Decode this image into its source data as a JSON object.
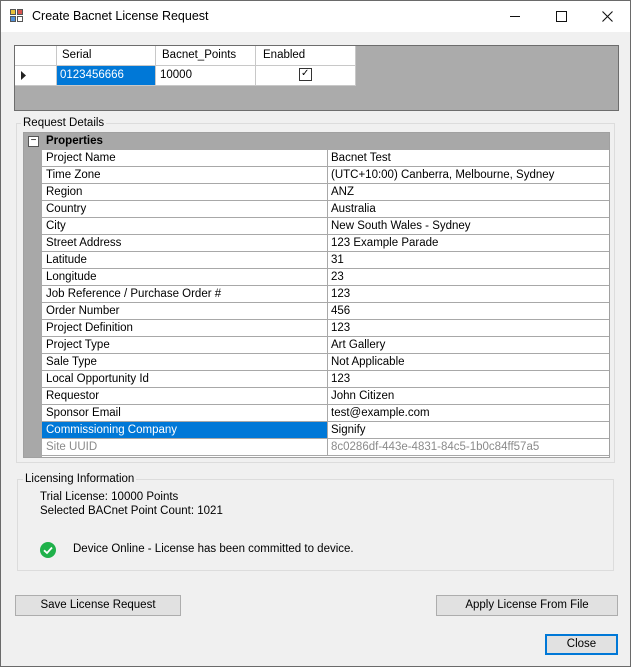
{
  "window": {
    "title": "Create Bacnet License Request"
  },
  "grid": {
    "columns": [
      "Serial",
      "Bacnet_Points",
      "Enabled"
    ],
    "row": {
      "serial": "0123456666",
      "points": "10000",
      "enabled_glyph": "✓"
    }
  },
  "request_details": {
    "title": "Request Details",
    "category": "Properties",
    "collapse_glyph": "−",
    "properties": [
      {
        "name": "Project Name",
        "value": "Bacnet Test"
      },
      {
        "name": "Time Zone",
        "value": "(UTC+10:00) Canberra, Melbourne, Sydney"
      },
      {
        "name": "Region",
        "value": "ANZ"
      },
      {
        "name": "Country",
        "value": "Australia"
      },
      {
        "name": "City",
        "value": "New South Wales - Sydney"
      },
      {
        "name": "Street Address",
        "value": "123 Example Parade"
      },
      {
        "name": "Latitude",
        "value": "31"
      },
      {
        "name": "Longitude",
        "value": "23"
      },
      {
        "name": "Job Reference / Purchase Order #",
        "value": "123"
      },
      {
        "name": "Order Number",
        "value": "456"
      },
      {
        "name": "Project Definition",
        "value": "123"
      },
      {
        "name": "Project Type",
        "value": "Art Gallery"
      },
      {
        "name": "Sale Type",
        "value": "Not Applicable"
      },
      {
        "name": "Local Opportunity Id",
        "value": "123"
      },
      {
        "name": "Requestor",
        "value": "John Citizen"
      },
      {
        "name": "Sponsor Email",
        "value": "test@example.com"
      },
      {
        "name": "Commissioning Company",
        "value": "Signify"
      },
      {
        "name": "Site UUID",
        "value": "8c0286df-443e-4831-84c5-1b0c84ff57a5"
      }
    ]
  },
  "licensing": {
    "title": "Licensing Information",
    "trial": "Trial License: 10000 Points",
    "selected": "Selected BACnet Point Count: 1021",
    "status": "Device Online - License has been committed to device.",
    "status_color": "#1fb14a"
  },
  "buttons": {
    "save": "Save License Request",
    "apply": "Apply License From File",
    "close": "Close"
  },
  "colors": {
    "selection": "#0078d7"
  }
}
